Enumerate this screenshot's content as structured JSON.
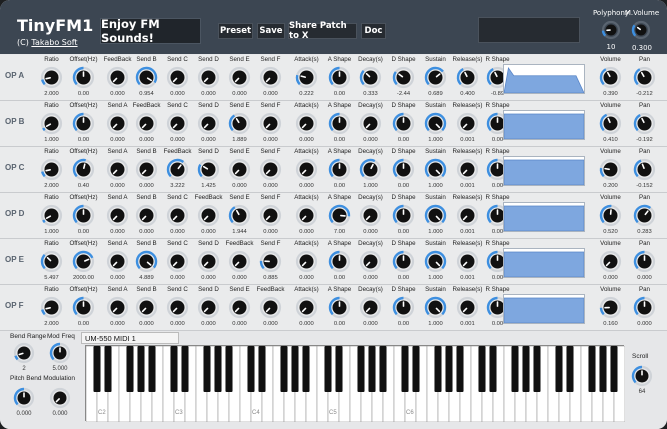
{
  "app": {
    "title": "TinyFM1",
    "credit_prefix": "(C) ",
    "credit_author": "Takabo Soft",
    "banner": "Enjoy FM Sounds!"
  },
  "buttons": {
    "preset": "Preset",
    "save": "Save",
    "share": "Share Patch to X",
    "doc": "Doc"
  },
  "globals": {
    "polyphony_label": "Polyphony",
    "polyphony_value": "10",
    "polyphony_level": 0.15,
    "mvolume_label": "M.Volume",
    "mvolume_value": "0.300",
    "mvolume_level": 0.3
  },
  "colors": {
    "header": "#3c4652",
    "arc": "#3d8fe0",
    "envelope_fill": "#7ea7df"
  },
  "operators": [
    {
      "name": "OP A",
      "params": [
        {
          "label": "Ratio",
          "value": "2.000",
          "level": 0.12
        },
        {
          "label": "Offset(Hz)",
          "value": "0.00",
          "level": 0.5
        },
        {
          "label": "FeedBack",
          "value": "0.000",
          "level": 0
        },
        {
          "label": "Send B",
          "value": "0.954",
          "level": 0.95
        },
        {
          "label": "Send C",
          "value": "0.000",
          "level": 0
        },
        {
          "label": "Send D",
          "value": "0.000",
          "level": 0
        },
        {
          "label": "Send E",
          "value": "0.000",
          "level": 0
        },
        {
          "label": "Send F",
          "value": "0.000",
          "level": 0
        },
        {
          "label": "Attack(s)",
          "value": "0.222",
          "level": 0.22
        },
        {
          "label": "A Shape",
          "value": "0.00",
          "level": 0.5
        },
        {
          "label": "Decay(s)",
          "value": "0.333",
          "level": 0.33
        },
        {
          "label": "D Shape",
          "value": "-2.44",
          "level": 0.3
        },
        {
          "label": "Sustain",
          "value": "0.689",
          "level": 0.69
        },
        {
          "label": "Release(s)",
          "value": "0.400",
          "level": 0.4
        },
        {
          "label": "R Shape",
          "value": "-0.89",
          "level": 0.4
        }
      ],
      "envelope": {
        "attack": 0.222,
        "decay": 0.333,
        "sustain": 0.689,
        "release": 0.4
      },
      "volume": {
        "label": "Volume",
        "value": "0.390",
        "level": 0.39
      },
      "pan": {
        "label": "Pan",
        "value": "-0.212",
        "level": 0.39
      }
    },
    {
      "name": "OP B",
      "params": [
        {
          "label": "Ratio",
          "value": "1.000",
          "level": 0.06
        },
        {
          "label": "Offset(Hz)",
          "value": "0.00",
          "level": 0.5
        },
        {
          "label": "Send A",
          "value": "0.000",
          "level": 0
        },
        {
          "label": "FeedBack",
          "value": "0.000",
          "level": 0
        },
        {
          "label": "Send C",
          "value": "0.000",
          "level": 0
        },
        {
          "label": "Send D",
          "value": "0.000",
          "level": 0
        },
        {
          "label": "Send E",
          "value": "1.889",
          "level": 0.38
        },
        {
          "label": "Send F",
          "value": "0.000",
          "level": 0
        },
        {
          "label": "Attack(s)",
          "value": "0.000",
          "level": 0
        },
        {
          "label": "A Shape",
          "value": "0.00",
          "level": 0.5
        },
        {
          "label": "Decay(s)",
          "value": "0.000",
          "level": 0
        },
        {
          "label": "D Shape",
          "value": "0.00",
          "level": 0.5
        },
        {
          "label": "Sustain",
          "value": "1.000",
          "level": 1
        },
        {
          "label": "Release(s)",
          "value": "0.001",
          "level": 0
        },
        {
          "label": "R Shape",
          "value": "0.00",
          "level": 0.5
        }
      ],
      "envelope": {
        "attack": 0,
        "decay": 0,
        "sustain": 1,
        "release": 0.001
      },
      "volume": {
        "label": "Volume",
        "value": "0.410",
        "level": 0.41
      },
      "pan": {
        "label": "Pan",
        "value": "-0.192",
        "level": 0.4
      }
    },
    {
      "name": "OP C",
      "params": [
        {
          "label": "Ratio",
          "value": "2.000",
          "level": 0.12
        },
        {
          "label": "Offset(Hz)",
          "value": "0.40",
          "level": 0.55
        },
        {
          "label": "Send A",
          "value": "0.000",
          "level": 0
        },
        {
          "label": "Send B",
          "value": "0.000",
          "level": 0
        },
        {
          "label": "FeedBack",
          "value": "3.222",
          "level": 0.64
        },
        {
          "label": "Send D",
          "value": "1.425",
          "level": 0.28
        },
        {
          "label": "Send E",
          "value": "0.000",
          "level": 0
        },
        {
          "label": "Send F",
          "value": "0.000",
          "level": 0
        },
        {
          "label": "Attack(s)",
          "value": "0.000",
          "level": 0
        },
        {
          "label": "A Shape",
          "value": "0.00",
          "level": 0.5
        },
        {
          "label": "Decay(s)",
          "value": "1.000",
          "level": 0.6
        },
        {
          "label": "D Shape",
          "value": "0.00",
          "level": 0.5
        },
        {
          "label": "Sustain",
          "value": "1.000",
          "level": 1
        },
        {
          "label": "Release(s)",
          "value": "0.001",
          "level": 0
        },
        {
          "label": "R Shape",
          "value": "0.00",
          "level": 0.5
        }
      ],
      "envelope": {
        "attack": 0,
        "decay": 1,
        "sustain": 1,
        "release": 0.001
      },
      "volume": {
        "label": "Volume",
        "value": "0.200",
        "level": 0.2
      },
      "pan": {
        "label": "Pan",
        "value": "-0.152",
        "level": 0.42
      }
    },
    {
      "name": "OP D",
      "params": [
        {
          "label": "Ratio",
          "value": "1.000",
          "level": 0.06
        },
        {
          "label": "Offset(Hz)",
          "value": "0.00",
          "level": 0.5
        },
        {
          "label": "Send A",
          "value": "0.000",
          "level": 0
        },
        {
          "label": "Send B",
          "value": "0.000",
          "level": 0
        },
        {
          "label": "Send C",
          "value": "0.000",
          "level": 0
        },
        {
          "label": "FeedBack",
          "value": "0.000",
          "level": 0
        },
        {
          "label": "Send E",
          "value": "1.944",
          "level": 0.39
        },
        {
          "label": "Send F",
          "value": "0.000",
          "level": 0
        },
        {
          "label": "Attack(s)",
          "value": "0.000",
          "level": 0
        },
        {
          "label": "A Shape",
          "value": "7.00",
          "level": 0.85
        },
        {
          "label": "Decay(s)",
          "value": "0.000",
          "level": 0
        },
        {
          "label": "D Shape",
          "value": "0.00",
          "level": 0.5
        },
        {
          "label": "Sustain",
          "value": "1.000",
          "level": 1
        },
        {
          "label": "Release(s)",
          "value": "0.001",
          "level": 0
        },
        {
          "label": "R Shape",
          "value": "0.00",
          "level": 0.5
        }
      ],
      "envelope": {
        "attack": 0,
        "decay": 0,
        "sustain": 1,
        "release": 0.001
      },
      "volume": {
        "label": "Volume",
        "value": "0.520",
        "level": 0.52
      },
      "pan": {
        "label": "Pan",
        "value": "0.283",
        "level": 0.64
      }
    },
    {
      "name": "OP E",
      "params": [
        {
          "label": "Ratio",
          "value": "5.497",
          "level": 0.33
        },
        {
          "label": "Offset(Hz)",
          "value": "2000.00",
          "level": 0.75
        },
        {
          "label": "Send A",
          "value": "0.000",
          "level": 0
        },
        {
          "label": "Send B",
          "value": "4.889",
          "level": 0.98
        },
        {
          "label": "Send C",
          "value": "0.000",
          "level": 0
        },
        {
          "label": "Send D",
          "value": "0.000",
          "level": 0
        },
        {
          "label": "FeedBack",
          "value": "0.000",
          "level": 0
        },
        {
          "label": "Send F",
          "value": "0.885",
          "level": 0.18
        },
        {
          "label": "Attack(s)",
          "value": "0.000",
          "level": 0
        },
        {
          "label": "A Shape",
          "value": "0.00",
          "level": 0.5
        },
        {
          "label": "Decay(s)",
          "value": "0.000",
          "level": 0
        },
        {
          "label": "D Shape",
          "value": "0.00",
          "level": 0.5
        },
        {
          "label": "Sustain",
          "value": "1.000",
          "level": 1
        },
        {
          "label": "Release(s)",
          "value": "0.001",
          "level": 0
        },
        {
          "label": "R Shape",
          "value": "0.00",
          "level": 0.5
        }
      ],
      "envelope": {
        "attack": 0,
        "decay": 0,
        "sustain": 1,
        "release": 0.001
      },
      "volume": {
        "label": "Volume",
        "value": "0.000",
        "level": 0
      },
      "pan": {
        "label": "Pan",
        "value": "0.000",
        "level": 0.5
      }
    },
    {
      "name": "OP F",
      "params": [
        {
          "label": "Ratio",
          "value": "2.000",
          "level": 0.12
        },
        {
          "label": "Offset(Hz)",
          "value": "0.00",
          "level": 0.5
        },
        {
          "label": "Send A",
          "value": "0.000",
          "level": 0
        },
        {
          "label": "Send B",
          "value": "0.000",
          "level": 0
        },
        {
          "label": "Send C",
          "value": "0.000",
          "level": 0
        },
        {
          "label": "Send D",
          "value": "0.000",
          "level": 0
        },
        {
          "label": "Send E",
          "value": "0.000",
          "level": 0
        },
        {
          "label": "FeedBack",
          "value": "0.000",
          "level": 0
        },
        {
          "label": "Attack(s)",
          "value": "0.000",
          "level": 0
        },
        {
          "label": "A Shape",
          "value": "0.00",
          "level": 0.5
        },
        {
          "label": "Decay(s)",
          "value": "0.000",
          "level": 0
        },
        {
          "label": "D Shape",
          "value": "0.00",
          "level": 0.5
        },
        {
          "label": "Sustain",
          "value": "1.000",
          "level": 1
        },
        {
          "label": "Release(s)",
          "value": "0.001",
          "level": 0
        },
        {
          "label": "R Shape",
          "value": "0.00",
          "level": 0.5
        }
      ],
      "envelope": {
        "attack": 0,
        "decay": 0,
        "sustain": 1,
        "release": 0.001
      },
      "volume": {
        "label": "Volume",
        "value": "0.160",
        "level": 0.16
      },
      "pan": {
        "label": "Pan",
        "value": "0.000",
        "level": 0.5
      }
    }
  ],
  "bottom": {
    "bend_range_label": "Bend Range",
    "bend_range_value": "2",
    "bend_range_level": 0.1,
    "mod_freq_label": "Mod Freq",
    "mod_freq_value": "5.000",
    "mod_freq_level": 0.5,
    "pitch_mod_label": "Pitch Bend Modulation",
    "pitch_bend_value": "0.000",
    "pitch_bend_level": 0.5,
    "modulation_value": "0.000",
    "modulation_level": 0,
    "midi_device": "UM-550 MIDI 1",
    "scroll_label": "Scroll",
    "scroll_value": "64",
    "scroll_level": 0.5
  },
  "keyboard": {
    "octave_labels": [
      "C2",
      "C3",
      "C4",
      "C5",
      "C6"
    ]
  }
}
